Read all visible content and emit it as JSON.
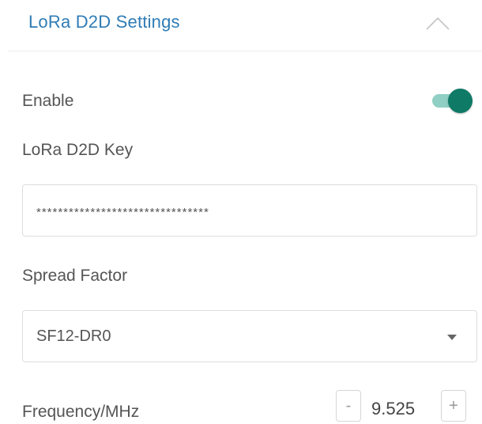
{
  "section": {
    "title": "LoRa D2D Settings"
  },
  "enable": {
    "label": "Enable",
    "checked": true
  },
  "d2d_key": {
    "label": "LoRa D2D Key",
    "value": "********************************"
  },
  "spread_factor": {
    "label": "Spread Factor",
    "selected": "SF12-DR0"
  },
  "frequency": {
    "label": "Frequency/MHz",
    "decrement_label": "-",
    "value": "9.525",
    "increment_label": "+"
  },
  "colors": {
    "title": "#2f7cb5",
    "toggle_on_thumb": "#0f7a66",
    "toggle_on_track": "#8fcfc4"
  },
  "icons": {
    "collapse": "chevron-up-icon",
    "dropdown": "caret-down-icon"
  }
}
